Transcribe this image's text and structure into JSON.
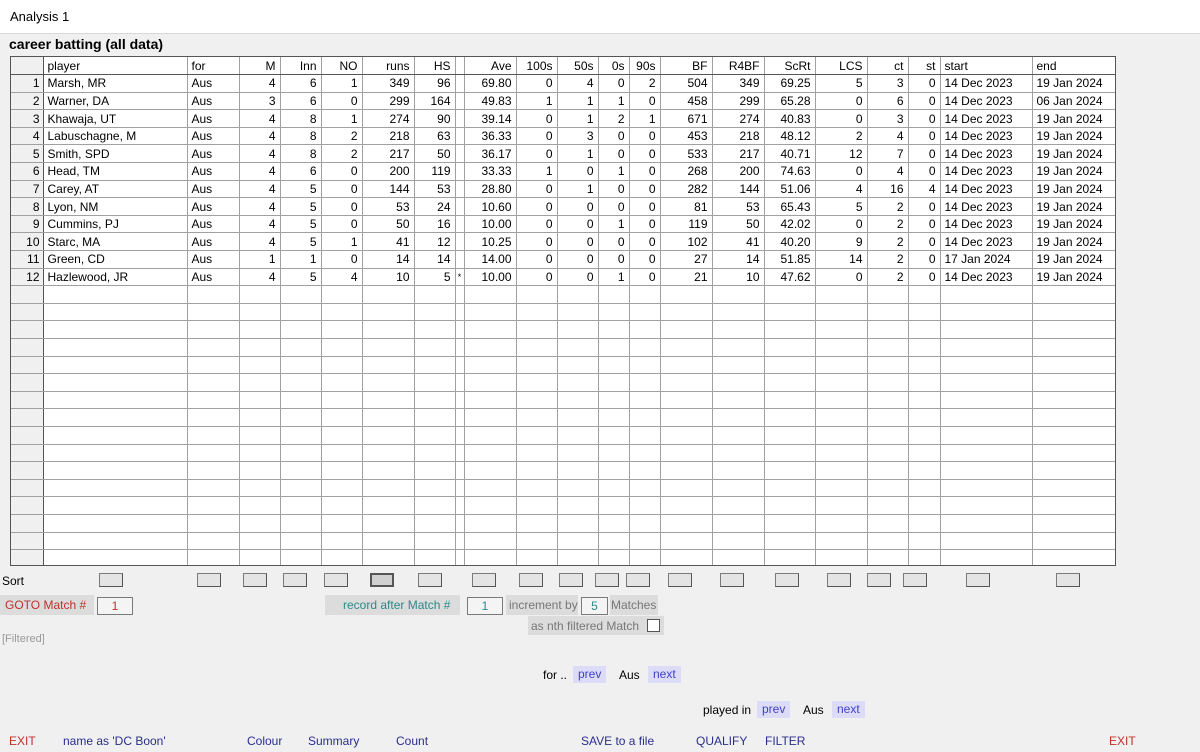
{
  "window": {
    "title": "Analysis 1"
  },
  "heading": "career batting (all data)",
  "table": {
    "columns": [
      "player",
      "for",
      "M",
      "Inn",
      "NO",
      "runs",
      "HS",
      "",
      "Ave",
      "100s",
      "50s",
      "0s",
      "90s",
      "BF",
      "R4BF",
      "ScRt",
      "LCS",
      "ct",
      "st",
      "start",
      "end"
    ],
    "rows": [
      [
        "1",
        "Marsh, MR",
        "Aus",
        "4",
        "6",
        "1",
        "349",
        "96",
        "",
        "69.80",
        "0",
        "4",
        "0",
        "2",
        "504",
        "349",
        "69.25",
        "5",
        "3",
        "0",
        "14 Dec 2023",
        "19 Jan 2024"
      ],
      [
        "2",
        "Warner, DA",
        "Aus",
        "3",
        "6",
        "0",
        "299",
        "164",
        "",
        "49.83",
        "1",
        "1",
        "1",
        "0",
        "458",
        "299",
        "65.28",
        "0",
        "6",
        "0",
        "14 Dec 2023",
        "06 Jan 2024"
      ],
      [
        "3",
        "Khawaja, UT",
        "Aus",
        "4",
        "8",
        "1",
        "274",
        "90",
        "",
        "39.14",
        "0",
        "1",
        "2",
        "1",
        "671",
        "274",
        "40.83",
        "0",
        "3",
        "0",
        "14 Dec 2023",
        "19 Jan 2024"
      ],
      [
        "4",
        "Labuschagne, M",
        "Aus",
        "4",
        "8",
        "2",
        "218",
        "63",
        "",
        "36.33",
        "0",
        "3",
        "0",
        "0",
        "453",
        "218",
        "48.12",
        "2",
        "4",
        "0",
        "14 Dec 2023",
        "19 Jan 2024"
      ],
      [
        "5",
        "Smith, SPD",
        "Aus",
        "4",
        "8",
        "2",
        "217",
        "50",
        "",
        "36.17",
        "0",
        "1",
        "0",
        "0",
        "533",
        "217",
        "40.71",
        "12",
        "7",
        "0",
        "14 Dec 2023",
        "19 Jan 2024"
      ],
      [
        "6",
        "Head, TM",
        "Aus",
        "4",
        "6",
        "0",
        "200",
        "119",
        "",
        "33.33",
        "1",
        "0",
        "1",
        "0",
        "268",
        "200",
        "74.63",
        "0",
        "4",
        "0",
        "14 Dec 2023",
        "19 Jan 2024"
      ],
      [
        "7",
        "Carey, AT",
        "Aus",
        "4",
        "5",
        "0",
        "144",
        "53",
        "",
        "28.80",
        "0",
        "1",
        "0",
        "0",
        "282",
        "144",
        "51.06",
        "4",
        "16",
        "4",
        "14 Dec 2023",
        "19 Jan 2024"
      ],
      [
        "8",
        "Lyon, NM",
        "Aus",
        "4",
        "5",
        "0",
        "53",
        "24",
        "",
        "10.60",
        "0",
        "0",
        "0",
        "0",
        "81",
        "53",
        "65.43",
        "5",
        "2",
        "0",
        "14 Dec 2023",
        "19 Jan 2024"
      ],
      [
        "9",
        "Cummins, PJ",
        "Aus",
        "4",
        "5",
        "0",
        "50",
        "16",
        "",
        "10.00",
        "0",
        "0",
        "1",
        "0",
        "119",
        "50",
        "42.02",
        "0",
        "2",
        "0",
        "14 Dec 2023",
        "19 Jan 2024"
      ],
      [
        "10",
        "Starc, MA",
        "Aus",
        "4",
        "5",
        "1",
        "41",
        "12",
        "",
        "10.25",
        "0",
        "0",
        "0",
        "0",
        "102",
        "41",
        "40.20",
        "9",
        "2",
        "0",
        "14 Dec 2023",
        "19 Jan 2024"
      ],
      [
        "11",
        "Green, CD",
        "Aus",
        "1",
        "1",
        "0",
        "14",
        "14",
        "",
        "14.00",
        "0",
        "0",
        "0",
        "0",
        "27",
        "14",
        "51.85",
        "14",
        "2",
        "0",
        "17 Jan 2024",
        "19 Jan 2024"
      ],
      [
        "12",
        "Hazlewood, JR",
        "Aus",
        "4",
        "5",
        "4",
        "10",
        "5",
        "*",
        "10.00",
        "0",
        "0",
        "1",
        "0",
        "21",
        "10",
        "47.62",
        "0",
        "2",
        "0",
        "14 Dec 2023",
        "19 Jan 2024"
      ]
    ],
    "empty_row_count": 16
  },
  "sort": {
    "label": "Sort"
  },
  "goto": {
    "label": "GOTO Match #",
    "value": "1"
  },
  "record": {
    "label": "record after Match #",
    "value": "1",
    "increment_label": "increment by",
    "increment_value": "5",
    "matches_label": "Matches",
    "nth_label": "as nth filtered Match"
  },
  "filtered_label": "[Filtered]",
  "for_nav": {
    "label": "for ..",
    "prev": "prev",
    "value": "Aus",
    "next": "next"
  },
  "played_nav": {
    "label": "played in",
    "prev": "prev",
    "value": "Aus",
    "next": "next"
  },
  "bottom": {
    "exit_left": "EXIT",
    "name_as": "name as 'DC Boon'",
    "colour": "Colour",
    "summary": "Summary",
    "count": "Count",
    "save": "SAVE to a file",
    "qualify": "QUALIFY",
    "filter": "FILTER",
    "exit_right": "EXIT"
  },
  "colors": {
    "red": "#c0302a",
    "teal": "#2a8a8a",
    "navy": "#2b2e8c",
    "link": "#4040c8"
  }
}
